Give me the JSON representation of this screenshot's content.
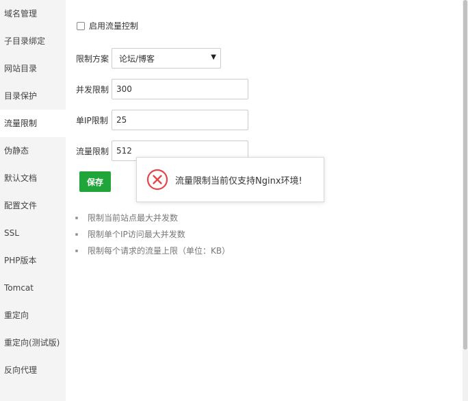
{
  "sidebar": {
    "items": [
      {
        "label": "域名管理"
      },
      {
        "label": "子目录绑定"
      },
      {
        "label": "网站目录"
      },
      {
        "label": "目录保护"
      },
      {
        "label": "流量限制"
      },
      {
        "label": "伪静态"
      },
      {
        "label": "默认文档"
      },
      {
        "label": "配置文件"
      },
      {
        "label": "SSL"
      },
      {
        "label": "PHP版本"
      },
      {
        "label": "Tomcat"
      },
      {
        "label": "重定向"
      },
      {
        "label": "重定向(测试版)"
      },
      {
        "label": "反向代理"
      }
    ],
    "active_index": 4
  },
  "form": {
    "enable_label": "启用流量控制",
    "enable_checked": false,
    "scheme_label": "限制方案",
    "scheme_value": "论坛/博客",
    "concurrency_label": "并发限制",
    "concurrency_value": "300",
    "per_ip_label": "单IP限制",
    "per_ip_value": "25",
    "traffic_label": "流量限制",
    "traffic_value": "512",
    "save_label": "保存"
  },
  "tips": [
    "限制当前站点最大并发数",
    "限制单个IP访问最大并发数",
    "限制每个请求的流量上限（单位：KB）"
  ],
  "toast": {
    "icon": "error-circle-icon",
    "message": "流量限制当前仅支持Nginx环境!"
  },
  "colors": {
    "accent": "#20a53a",
    "error": "#e64545",
    "sidebar_bg": "#f4f4f4"
  }
}
